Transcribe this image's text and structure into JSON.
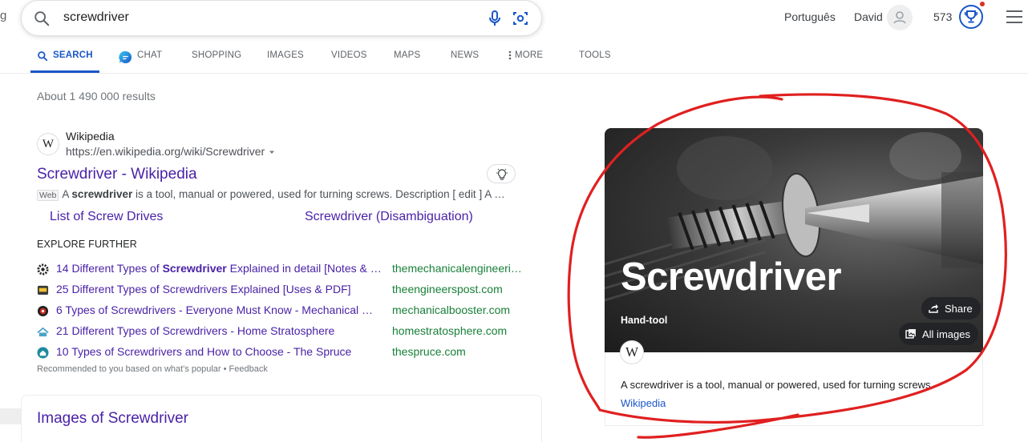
{
  "edge_letter": "g",
  "search": {
    "query": "screwdriver"
  },
  "header": {
    "language": "Português",
    "user_name": "David",
    "points": "573"
  },
  "tabs": [
    {
      "label": "SEARCH",
      "active": true
    },
    {
      "label": "CHAT"
    },
    {
      "label": "SHOPPING"
    },
    {
      "label": "IMAGES"
    },
    {
      "label": "VIDEOS"
    },
    {
      "label": "MAPS"
    },
    {
      "label": "NEWS"
    },
    {
      "label": "MORE"
    },
    {
      "label": "TOOLS"
    }
  ],
  "results_count": "About 1 490 000 results",
  "wiki_result": {
    "favicon_letter": "W",
    "site_name": "Wikipedia",
    "url": "https://en.wikipedia.org/wiki/Screwdriver",
    "title": "Screwdriver - Wikipedia",
    "badge": "Web",
    "snippet_pre": "A ",
    "snippet_bold": "screwdriver",
    "snippet_post": " is a tool, manual or powered, used for turning screws. Description [ edit ] A …",
    "sublinks": [
      "List of Screw Drives",
      "Screwdriver (Disambiguation)"
    ]
  },
  "explore": {
    "heading": "EXPLORE FURTHER",
    "items": [
      {
        "title_pre": "14 Different Types of ",
        "title_bold": "Screwdriver",
        "title_post": " Explained in detail [Notes & …",
        "domain": "themechanicalengineeri…",
        "icon_color": "#222222"
      },
      {
        "title_pre": "25 Different Types of Screwdrivers Explained [Uses & PDF]",
        "title_bold": "",
        "title_post": "",
        "domain": "theengineerspost.com",
        "icon_color": "#3a3a3a"
      },
      {
        "title_pre": "6 Types of Screwdrivers - Everyone Must Know - Mechanical …",
        "title_bold": "",
        "title_post": "",
        "domain": "mechanicalbooster.com",
        "icon_color": "#d93025"
      },
      {
        "title_pre": "21 Different Types of Screwdrivers - Home Stratosphere",
        "title_bold": "",
        "title_post": "",
        "domain": "homestratosphere.com",
        "icon_color": "#4aa3c8"
      },
      {
        "title_pre": "10 Types of Screwdrivers and How to Choose - The Spruce",
        "title_bold": "",
        "title_post": "",
        "domain": "thespruce.com",
        "icon_color": "#1e8aa0"
      }
    ],
    "footer": "Recommended to you based on what's popular • Feedback"
  },
  "images_section": {
    "title": "Images of Screwdriver"
  },
  "knowledge_panel": {
    "title": "Screwdriver",
    "subtitle": "Hand-tool",
    "share_label": "Share",
    "all_images_label": "All images",
    "favicon_letter": "W",
    "description": "A screwdriver is a tool, manual or powered, used for turning screws.",
    "source": "Wikipedia"
  },
  "colors": {
    "accent": "#1a56c9",
    "link_visited": "#4a22a8",
    "domain_green": "#188038",
    "annotation_red": "#e02020"
  }
}
